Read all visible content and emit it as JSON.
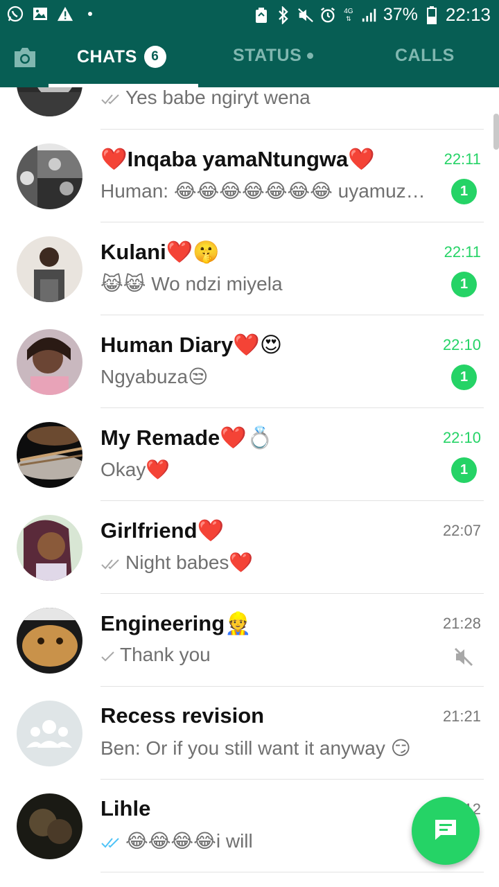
{
  "statusbar": {
    "left_icons": [
      "whatsapp-icon",
      "image-icon",
      "warning-icon",
      "dot-icon"
    ],
    "right_icons": [
      "recycle-icon",
      "bluetooth-icon",
      "mute-icon",
      "alarm-icon",
      "4g-icon",
      "signal-icon"
    ],
    "network": "4G",
    "battery": "37%",
    "time": "22:13"
  },
  "tabs": {
    "chats": "CHATS",
    "chats_badge": "6",
    "status": "STATUS",
    "calls": "CALLS"
  },
  "chats": [
    {
      "name": "",
      "preview": "Yes babe ngiryt wena",
      "time": "",
      "unread": "",
      "tick": "double-grey"
    },
    {
      "name": "❤️Inqaba yamaNtungwa❤️",
      "preview": "Human: 😂😂😂😂😂😂😂 uyamuz…",
      "time": "22:11",
      "unread": "1",
      "tick": ""
    },
    {
      "name": "Kulani❤️🤫",
      "preview": "😹😹 Wo ndzi miyela",
      "time": "22:11",
      "unread": "1",
      "tick": ""
    },
    {
      "name": "Human Diary❤️😍",
      "preview": "Ngyabuza😒",
      "time": "22:10",
      "unread": "1",
      "tick": ""
    },
    {
      "name": "My Remade❤️💍",
      "preview": "Okay❤️",
      "time": "22:10",
      "unread": "1",
      "tick": ""
    },
    {
      "name": "Girlfriend❤️",
      "preview": "Night babes❤️",
      "time": "22:07",
      "unread": "",
      "tick": "double-grey"
    },
    {
      "name": "Engineering👷",
      "preview": "Thank you",
      "time": "21:28",
      "unread": "",
      "tick": "single-grey",
      "muted": true
    },
    {
      "name": "Recess revision",
      "preview": "Ben: Or if you still want it anyway 😏",
      "time": "21:21",
      "unread": "",
      "tick": ""
    },
    {
      "name": "Lihle",
      "preview": "😂😂😂😂i will",
      "time": "22:12",
      "unread": "",
      "tick": "double-blue"
    }
  ],
  "colors": {
    "primary": "#075e54",
    "accent": "#25d366",
    "tick_blue": "#4fc3f7"
  },
  "fab_icon": "new-chat-icon"
}
